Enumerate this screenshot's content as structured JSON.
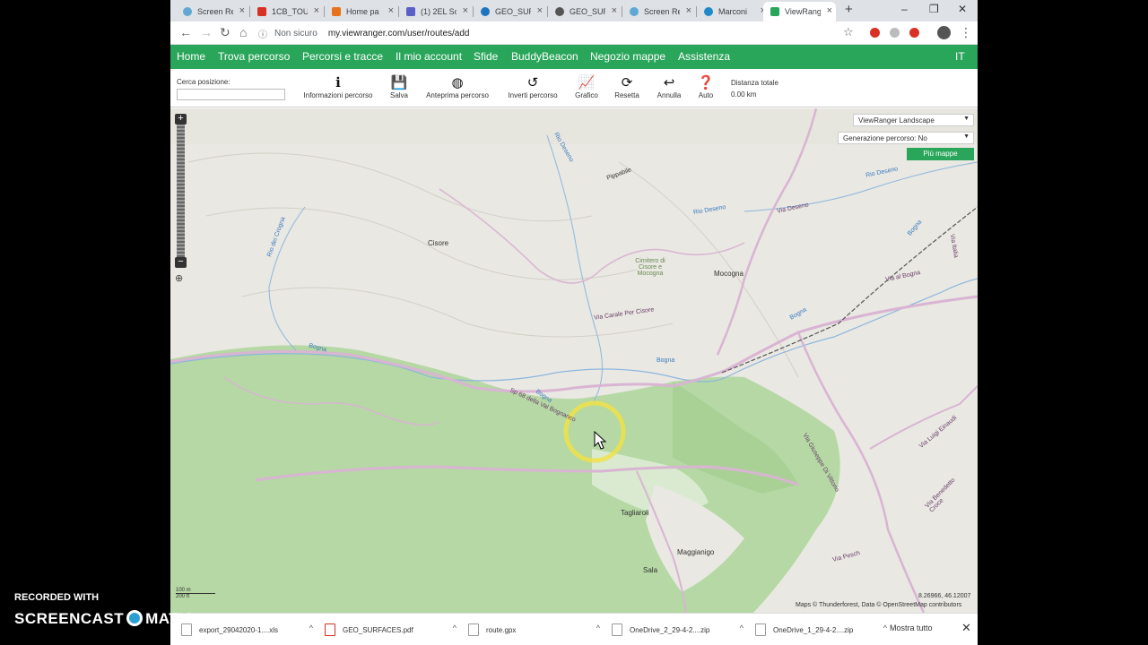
{
  "browser": {
    "tabs": [
      {
        "title": "Screen Re",
        "color": "#5fa8d3"
      },
      {
        "title": "1CB_TOUR",
        "color": "#d93025"
      },
      {
        "title": "Home pa",
        "color": "#e8711c"
      },
      {
        "title": "(1) 2EL Sc",
        "color": "#5b5fc7"
      },
      {
        "title": "GEO_SUR",
        "color": "#1e73be"
      },
      {
        "title": "GEO_SUR",
        "color": "#555555"
      },
      {
        "title": "Screen Re",
        "color": "#5fa8d3"
      },
      {
        "title": "Marconi",
        "color": "#1e88c8"
      },
      {
        "title": "ViewRang",
        "color": "#2aa65b"
      }
    ],
    "security": "Non sicuro",
    "url": "my.viewranger.com/user/routes/add"
  },
  "nav": [
    "Home",
    "Trova percorso",
    "Percorsi e tracce",
    "Il mio account",
    "Sfide",
    "BuddyBeacon",
    "Negozio mappe",
    "Assistenza"
  ],
  "lang": "IT",
  "routebar": {
    "search_label": "Cerca posizione:",
    "search_value": "",
    "tools": [
      {
        "label": "Informazioni percorso",
        "icon": "info-icon"
      },
      {
        "label": "Salva",
        "icon": "save-icon"
      },
      {
        "label": "Anteprima percorso",
        "icon": "globe-icon"
      },
      {
        "label": "Inverti percorso",
        "icon": "reverse-icon"
      },
      {
        "label": "Grafico",
        "icon": "chart-icon"
      },
      {
        "label": "Resetta",
        "icon": "reset-icon"
      },
      {
        "label": "Annulla",
        "icon": "undo-icon"
      },
      {
        "label": "Auto",
        "icon": "help-icon"
      }
    ],
    "distance_label": "Distanza totale",
    "distance_value": "0.00 km"
  },
  "map": {
    "layer_select": "ViewRanger Landscape",
    "generation_select": "Generazione percorso: No",
    "more_maps": "Più mappe",
    "places": [
      "Cisore",
      "Cimitero di Cisore e Mocogna",
      "Mocogna",
      "Tagliaroli",
      "Maggianigo",
      "Sala",
      "Pippabile"
    ],
    "water": [
      "Rio Deseno",
      "Rio Deseno",
      "Rio Deseno",
      "Rio dei Crogna",
      "Bogna",
      "Bogna",
      "Bogna",
      "Bogna",
      "Bogna"
    ],
    "roads": [
      "Via Deseno",
      "Via al Bogna",
      "Via Carale Per Cisore",
      "Sp 68 della Val Bognanco",
      "Via Giuseppe Di Vittorio",
      "Via Luigi Einaudi",
      "Via Benedetto Croce",
      "Via Pesch",
      "Via Italia"
    ],
    "scale_top": "100 m",
    "scale_bottom": "200 ft",
    "attribution": "Maps © Thunderforest, Data © OpenStreetMap contributors",
    "coords": "8.26966, 46.12007"
  },
  "downloads": [
    {
      "name": "export_29042020-1....xls"
    },
    {
      "name": "GEO_SURFACES.pdf"
    },
    {
      "name": "route.gpx"
    },
    {
      "name": "OneDrive_2_29-4-2....zip"
    },
    {
      "name": "OneDrive_1_29-4-2....zip"
    }
  ],
  "show_all": "Mostra tutto",
  "watermark": {
    "line1": "RECORDED WITH",
    "line2a": "SCREENCAST",
    "line2b": "MATIC"
  }
}
